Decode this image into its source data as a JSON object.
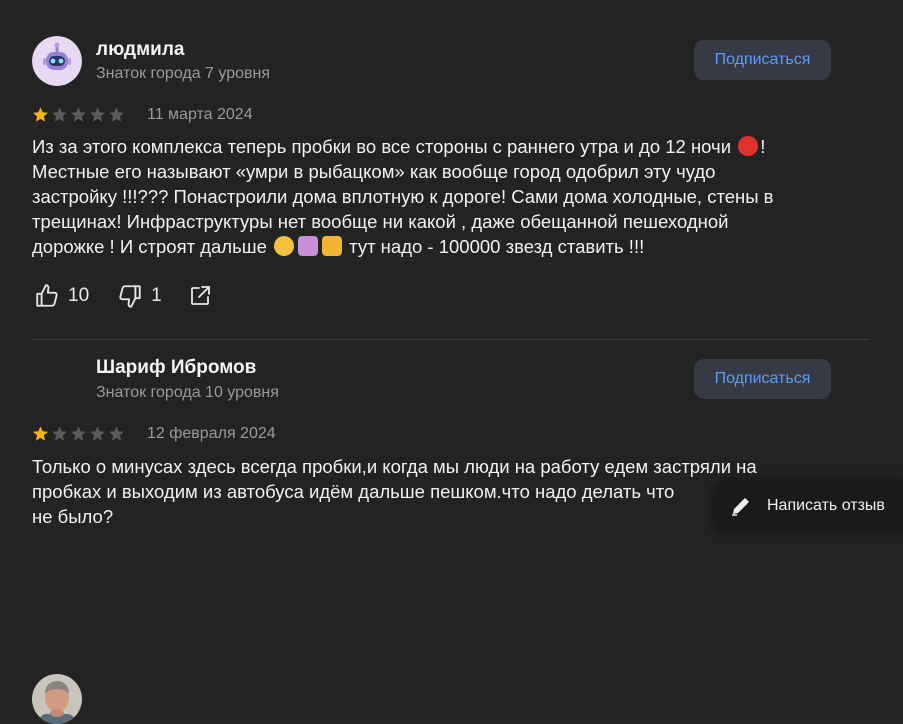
{
  "reviews": [
    {
      "author": "людмила",
      "level": "Знаток города 7 уровня",
      "subscribe_label": "Подписаться",
      "rating": 1,
      "date": "11 марта 2024",
      "text": {
        "l1a": "Из за этого комплекса теперь пробки во все стороны с раннего утра и до 12 ночи",
        "l1b": "!",
        "l2": "Местные его называют «умри в рыбацком» как вообще город одобрил эту чудо",
        "l3": "застройку !!!??? Понастроили дома вплотную к дороге! Сами дома холодные, стены в",
        "l4": "трещинах! Инфраструктуры нет вообще ни какой , даже обещанной пешеходной",
        "l5a": "дорожке ! И строят дальше",
        "l5b": "тут надо - 100000 звезд ставить !!!"
      },
      "likes": "10",
      "dislikes": "1"
    },
    {
      "author": "Шариф Ибромов",
      "level": "Знаток города 10 уровня",
      "subscribe_label": "Подписаться",
      "rating": 1,
      "date": "12 февраля 2024",
      "text": {
        "l1": "Только о минусах здесь всегда пробки,и когда мы люди на работу едем застряли на",
        "l2": "пробках и выходим из автобуса идём дальше пешком.что надо делать что",
        "l3": "не было?"
      }
    }
  ],
  "write_review_label": "Написать отзыв",
  "colors": {
    "background": "#232323",
    "star_filled": "#f5b614",
    "star_empty": "#5a5a5a",
    "subscribe_text": "#5b9bff"
  }
}
